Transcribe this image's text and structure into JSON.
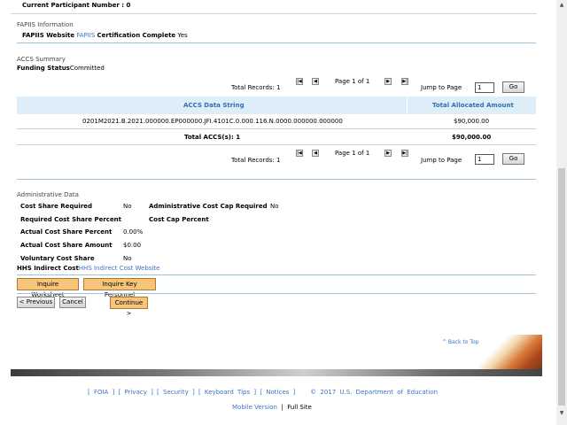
{
  "participant": {
    "label": "Current Participant Number :",
    "value": "0"
  },
  "fapiis": {
    "section_title": "FAPIIS Information",
    "website_label": "FAPIIS Website",
    "website_link": "FAPIIS",
    "cert_label": "Certification Complete",
    "cert_value": "Yes"
  },
  "accs": {
    "section_title": "ACCS Summary",
    "funding_label": "Funding Status",
    "funding_value": "Committed",
    "total_records_label": "Total Records:",
    "total_records": "1",
    "page_info": "Page 1 of 1",
    "jump_label": "Jump to Page",
    "jump_value": "1",
    "go_label": "Go",
    "pager_icons": {
      "first": "first-page-icon",
      "prev": "prev-page-icon",
      "next": "next-page-icon",
      "last": "last-page-icon"
    },
    "columns": [
      "ACCS Data String",
      "Total Allocated Amount"
    ],
    "rows": [
      {
        "data_string": "0201M2021.B.2021.000000.EP000000.JFI.4101C.0.000.116.N.0000.000000.000000",
        "amount": "$90,000.00"
      }
    ],
    "total_label": "Total ACCS(s): 1",
    "total_amount": "$90,000.00"
  },
  "admin": {
    "section_title": "Administrative Data",
    "cost_share_required_label": "Cost Share Required",
    "cost_share_required": "No",
    "admin_cost_cap_label": "Administrative Cost Cap Required",
    "admin_cost_cap": "No",
    "required_cost_share_pct_label": "Required Cost Share Percent",
    "cost_cap_pct_label": "Cost Cap Percent",
    "actual_cost_share_pct_label": "Actual Cost Share Percent",
    "actual_cost_share_pct": "0.00%",
    "actual_cost_share_amt_label": "Actual Cost Share Amount",
    "actual_cost_share_amt": "$0.00",
    "voluntary_cost_share_label": "Voluntary Cost Share",
    "voluntary_cost_share": "No",
    "hhs_label": "HHS Indirect Cost",
    "hhs_link": "HHS Indirect Cost Website"
  },
  "buttons": {
    "inquire_worksheet": "Inquire Worksheet",
    "inquire_key_personnel": "Inquire Key Personnel",
    "previous": "< Previous",
    "cancel": "Cancel",
    "continue": "Continue >"
  },
  "back_to_top": "^ Back to Top",
  "footer": {
    "links": [
      "[ FOIA ]",
      "[ Privacy ]",
      "[ Security ]",
      "[ Keyboard Tips ]",
      "[ Notices ]"
    ],
    "copyright": "© 2017 U.S. Department of Education",
    "mobile": "Mobile Version",
    "separator": "|",
    "full": "Full Site"
  },
  "colors": {
    "link": "#3b73c4",
    "header_bg": "#ddeef8",
    "accent_button": "#f6c57b"
  }
}
